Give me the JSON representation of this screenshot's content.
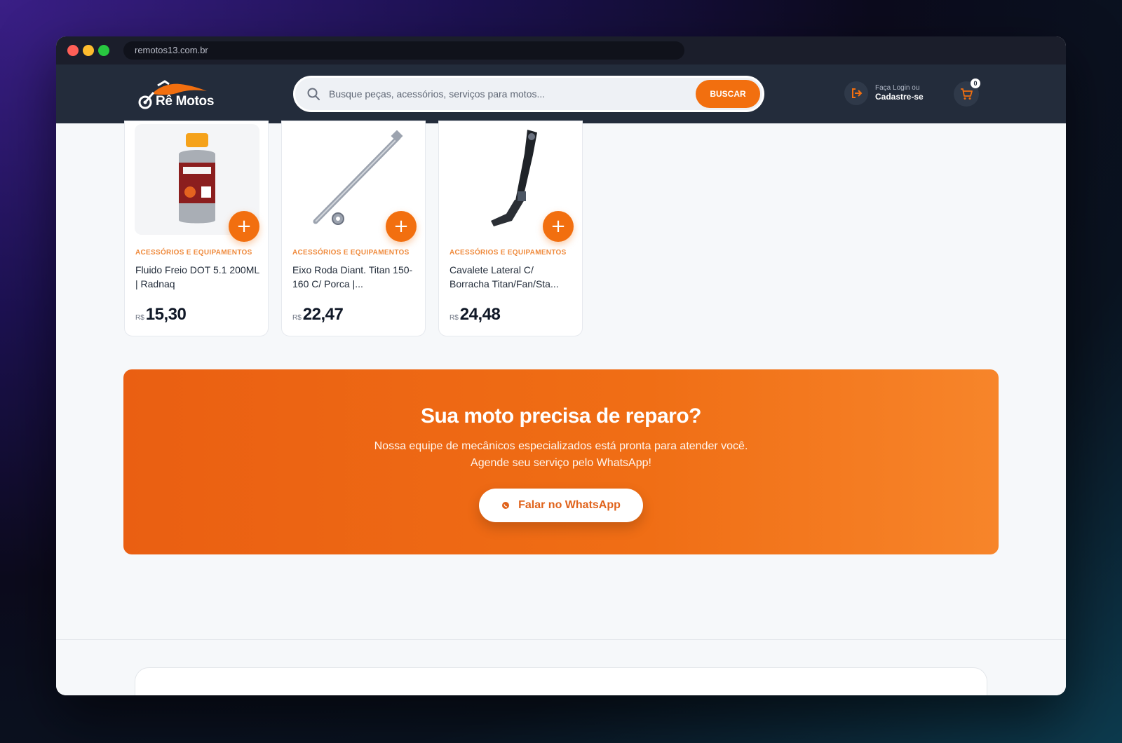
{
  "browser": {
    "url": "remotos13.com.br"
  },
  "header": {
    "logo_text": "Rê Motos",
    "search_placeholder": "Busque peças, acessórios, serviços para motos...",
    "search_button": "BUSCAR",
    "login_small": "Faça Login ou",
    "login_big": "Cadastre-se",
    "cart_count": "0"
  },
  "products": [
    {
      "category": "ACESSÓRIOS E EQUIPAMENTOS",
      "name": "Fluido Freio DOT 5.1 200ML | Radnaq",
      "currency": "R$",
      "price": "15,30",
      "add": "+"
    },
    {
      "category": "ACESSÓRIOS E EQUIPAMENTOS",
      "name": "Eixo Roda Diant. Titan 150-160 C/ Porca |...",
      "currency": "R$",
      "price": "22,47",
      "add": "+"
    },
    {
      "category": "ACESSÓRIOS E EQUIPAMENTOS",
      "name": "Cavalete Lateral C/ Borracha Titan/Fan/Sta...",
      "currency": "R$",
      "price": "24,48",
      "add": "+"
    }
  ],
  "cta": {
    "title": "Sua moto precisa de reparo?",
    "line1": "Nossa equipe de mecânicos especializados está pronta para atender você.",
    "line2": "Agende seu serviço pelo WhatsApp!",
    "button": "Falar no WhatsApp"
  },
  "colors": {
    "accent": "#f26f0f",
    "header_bg": "#232c3b"
  },
  "icons": {
    "search": "search-icon",
    "login": "login-icon",
    "cart": "cart-icon",
    "whatsapp": "whatsapp-icon"
  }
}
